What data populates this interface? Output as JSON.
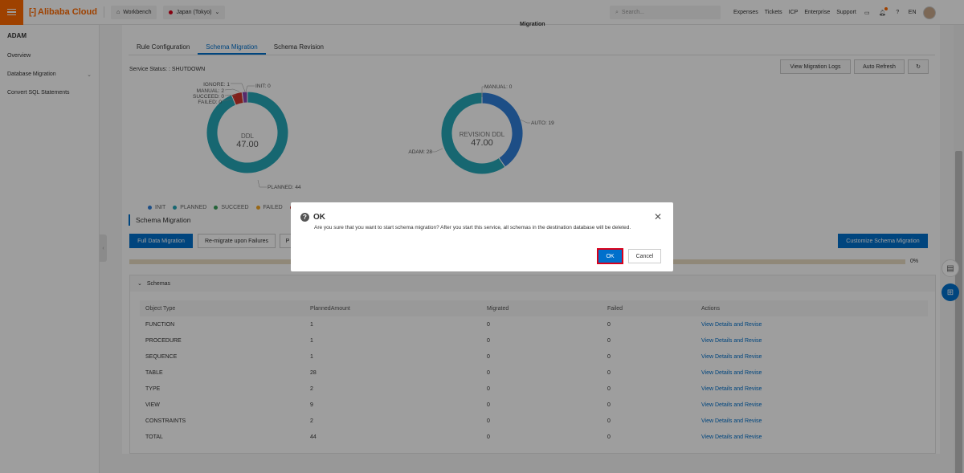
{
  "topbar": {
    "logo": "Alibaba Cloud",
    "workbench": "Workbench",
    "region": "Japan (Tokyo)",
    "search_placeholder": "Search...",
    "links": [
      "Expenses",
      "Tickets",
      "ICP",
      "Enterprise",
      "Support"
    ],
    "lang": "EN"
  },
  "sidebar": {
    "title": "ADAM",
    "items": [
      "Overview",
      "Database Migration",
      "Convert SQL Statements"
    ]
  },
  "main": {
    "title": "Migration",
    "tabs": [
      "Rule Configuration",
      "Schema Migration",
      "Schema Revision"
    ],
    "active_tab": "Schema Migration",
    "service_status": "Service Status: : SHUTDOWN",
    "header_buttons": {
      "logs": "View Migration Logs",
      "refresh": "Auto Refresh"
    }
  },
  "chart_data": [
    {
      "type": "pie",
      "center_label": "DDL",
      "center_value": "47.00",
      "slices": [
        {
          "label": "INIT",
          "value": 0,
          "color": "#2f7ed8"
        },
        {
          "label": "PLANNED",
          "value": 44,
          "color": "#26a6b7"
        },
        {
          "label": "SUCCEED",
          "value": 0,
          "color": "#3aa05b"
        },
        {
          "label": "FAILED",
          "value": 0,
          "color": "#f5a623"
        },
        {
          "label": "MANUAL",
          "value": 2,
          "color": "#d0342c"
        },
        {
          "label": "IGNORE",
          "value": 1,
          "color": "#8e44ad"
        }
      ],
      "annotations": [
        "IGNORE: 1",
        "INIT: 0",
        "MANUAL: 2",
        "SUCCEED: 0",
        "FAILED: 0",
        "PLANNED: 44"
      ]
    },
    {
      "type": "pie",
      "center_label": "REVISION DDL",
      "center_value": "47.00",
      "slices": [
        {
          "label": "MANUAL",
          "value": 0,
          "color": "#2f7ed8"
        },
        {
          "label": "AUTO",
          "value": 19,
          "color": "#2f7ed8"
        },
        {
          "label": "ADAM",
          "value": 28,
          "color": "#26a6b7"
        }
      ],
      "annotations": [
        "MANUAL: 0",
        "AUTO: 19",
        "ADAM: 28"
      ]
    }
  ],
  "legend": [
    {
      "label": "INIT",
      "color": "#2f7ed8"
    },
    {
      "label": "PLANNED",
      "color": "#26a6b7"
    },
    {
      "label": "SUCCEED",
      "color": "#3aa05b"
    },
    {
      "label": "FAILED",
      "color": "#f5a623"
    },
    {
      "label": "",
      "color": "#d0342c"
    }
  ],
  "schema_migration": {
    "title": "Schema Migration",
    "buttons": {
      "full": "Full Data Migration",
      "remigrate": "Re-migrate upon Failures",
      "partial": "P",
      "customize": "Customize Schema Migration"
    },
    "progress_percent": 0,
    "progress_text": "0%"
  },
  "schemas": {
    "title": "Schemas",
    "columns": [
      "Object Type",
      "PlannedAmount",
      "Migrated",
      "Failed",
      "Actions"
    ],
    "rows": [
      [
        "FUNCTION",
        "1",
        "0",
        "0",
        "View Details and Revise"
      ],
      [
        "PROCEDURE",
        "1",
        "0",
        "0",
        "View Details and Revise"
      ],
      [
        "SEQUENCE",
        "1",
        "0",
        "0",
        "View Details and Revise"
      ],
      [
        "TABLE",
        "28",
        "0",
        "0",
        "View Details and Revise"
      ],
      [
        "TYPE",
        "2",
        "0",
        "0",
        "View Details and Revise"
      ],
      [
        "VIEW",
        "9",
        "0",
        "0",
        "View Details and Revise"
      ],
      [
        "CONSTRAINTS",
        "2",
        "0",
        "0",
        "View Details and Revise"
      ],
      [
        "TOTAL",
        "44",
        "0",
        "0",
        "View Details and Revise"
      ]
    ]
  },
  "dialog": {
    "title": "OK",
    "message": "Are you sure that you want to start schema migration? After you start this service, all schemas in the destination database will be deleted.",
    "ok": "OK",
    "cancel": "Cancel"
  },
  "colors": {
    "brand": "#ff6a00",
    "primary": "#0070cc",
    "highlight": "#d9001b"
  }
}
